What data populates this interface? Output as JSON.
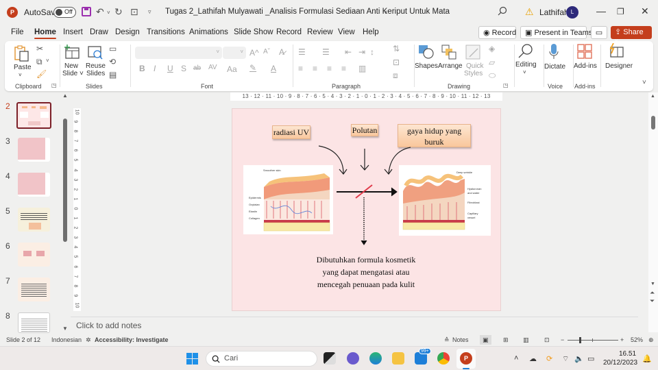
{
  "titlebar": {
    "app_icon": "powerpoint-icon",
    "autosave_label": "AutoSave",
    "autosave_state": "Off",
    "document_title": "Tugas 2_Lathifah Mulyawati _Analisis Formulasi Sediaan Anti Keriput Untuk Mata",
    "user_name": "Lathifah",
    "avatar_initial": "L",
    "minimize": "—",
    "restore": "❐",
    "close": "✕"
  },
  "menu": {
    "tabs": [
      "File",
      "Home",
      "Insert",
      "Draw",
      "Design",
      "Transitions",
      "Animations",
      "Slide Show",
      "Record",
      "Review",
      "View",
      "Help"
    ],
    "active_tab": "Home",
    "record_button": "Record",
    "present_teams_button": "Present in Teams",
    "share_button": "Share"
  },
  "ribbon": {
    "clipboard": {
      "paste": "Paste",
      "group": "Clipboard"
    },
    "slides": {
      "new_slide": "New Slide",
      "new_slide_l1": "New",
      "new_slide_l2": "Slide ˅",
      "reuse_l1": "Reuse",
      "reuse_l2": "Slides",
      "group": "Slides"
    },
    "font": {
      "group": "Font",
      "font_name": "",
      "font_size": "",
      "bold": "B",
      "italic": "I",
      "underline": "U",
      "shadow": "S",
      "strike": "ab",
      "spacing": "AV",
      "case": "Aa",
      "grow": "A^",
      "shrink": "Aˇ"
    },
    "paragraph": {
      "group": "Paragraph"
    },
    "drawing": {
      "shapes": "Shapes",
      "arrange": "Arrange",
      "quick_l1": "Quick",
      "quick_l2": "Styles",
      "group": "Drawing"
    },
    "editing": {
      "label": "Editing"
    },
    "voice": {
      "dictate": "Dictate",
      "group": "Voice"
    },
    "addins": {
      "label": "Add-ins",
      "group": "Add-ins"
    },
    "designer": {
      "label": "Designer"
    }
  },
  "thumbnails": [
    {
      "number": "2",
      "active": true
    },
    {
      "number": "3",
      "active": false
    },
    {
      "number": "4",
      "active": false
    },
    {
      "number": "5",
      "active": false
    },
    {
      "number": "6",
      "active": false
    },
    {
      "number": "7",
      "active": false
    },
    {
      "number": "8",
      "active": false
    }
  ],
  "ruler": {
    "horizontal": "13 · 12 · 11 · 10 · 9 · 8 · 7 · 6 · 5 · 4 · 3 · 2 · 1 · 0 · 1 · 2 · 3 · 4 · 5 · 6 · 7 · 8 · 9 · 10 · 11 · 12 · 13",
    "vertical": [
      "10",
      "9",
      "8",
      "7",
      "6",
      "5",
      "4",
      "3",
      "2",
      "1",
      "0",
      "1",
      "2",
      "3",
      "4",
      "5",
      "6",
      "7",
      "8",
      "9",
      "10"
    ]
  },
  "slide": {
    "callouts": {
      "uv": "radiasi UV",
      "pollutant": "Polutan",
      "lifestyle_l1": "gaya hidup yang",
      "lifestyle_l2": "buruk"
    },
    "left_image_labels": [
      "Smoother skin",
      "Epidermis",
      "Oxytalan",
      "Elastin",
      "Collagen"
    ],
    "right_image_labels": [
      "Deep wrinkle",
      "Hyaluronan",
      "and water",
      "Fibroblast",
      "Capillary",
      "vessel"
    ],
    "caption": [
      "Dibutuhkan formula kosmetik",
      "yang dapat mengatasi atau",
      "mencegah penuaan pada kulit"
    ],
    "colors": {
      "background": "#fce4e5",
      "callout": "#f9c79c",
      "blocked_mark": "#e03a4a"
    }
  },
  "notes": {
    "placeholder": "Click to add notes"
  },
  "statusbar": {
    "slide_info": "Slide 2 of 12",
    "language": "Indonesian",
    "accessibility": "Accessibility: Investigate",
    "notes_button": "Notes",
    "zoom_level": "52%",
    "zoom_fraction": 0.52
  },
  "taskbar": {
    "search_placeholder": "Cari",
    "mail_badge": "99+",
    "time": "16.51",
    "date": "20/12/2023"
  }
}
